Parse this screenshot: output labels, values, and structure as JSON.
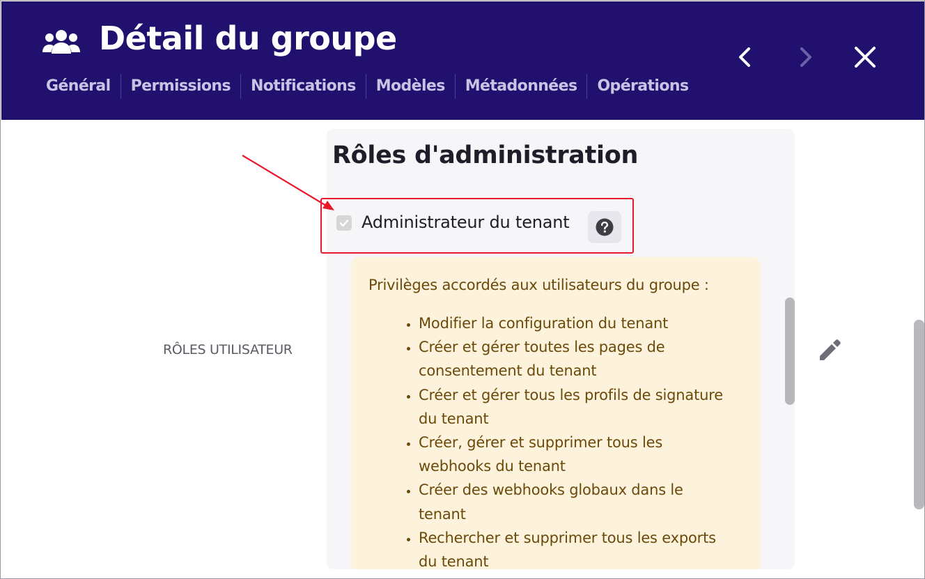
{
  "header": {
    "title": "Détail du groupe",
    "icon": "group-icon",
    "tabs": [
      {
        "label": "Général"
      },
      {
        "label": "Permissions"
      },
      {
        "label": "Notifications"
      },
      {
        "label": "Modèles"
      },
      {
        "label": "Métadonnées"
      },
      {
        "label": "Opérations"
      }
    ],
    "nav": {
      "previous_icon": "chevron-left-icon",
      "next_icon": "chevron-right-icon",
      "close_icon": "close-icon"
    }
  },
  "roles_label": "RÔLES UTILISATEUR",
  "admin_roles": {
    "heading": "Rôles d'administration",
    "tenant_admin": {
      "label": "Administrateur du tenant",
      "checked": true,
      "disabled": true
    },
    "help_icon": "question-circle-icon",
    "privileges_intro": "Privilèges accordés aux utilisateurs du groupe :",
    "privileges": [
      [
        "Modifier la configuration du tenant"
      ],
      [
        "Créer et gérer toutes les pages de",
        "consentement du tenant"
      ],
      [
        "Créer et gérer tous les profils de signature",
        "du tenant"
      ],
      [
        "Créer, gérer et supprimer tous les",
        "webhooks du tenant"
      ],
      [
        "Créer des webhooks globaux dans le",
        "tenant"
      ],
      [
        "Rechercher et supprimer tous les exports",
        "du tenant"
      ]
    ]
  },
  "edit_icon": "pencil-icon",
  "colors": {
    "header_bg": "#22106f",
    "tab_text": "#c8c4e6",
    "panel_bg": "#f6f6f8",
    "info_bg": "#fdf2dc",
    "info_text": "#6b4a0a",
    "annotation": "#e8192c"
  }
}
